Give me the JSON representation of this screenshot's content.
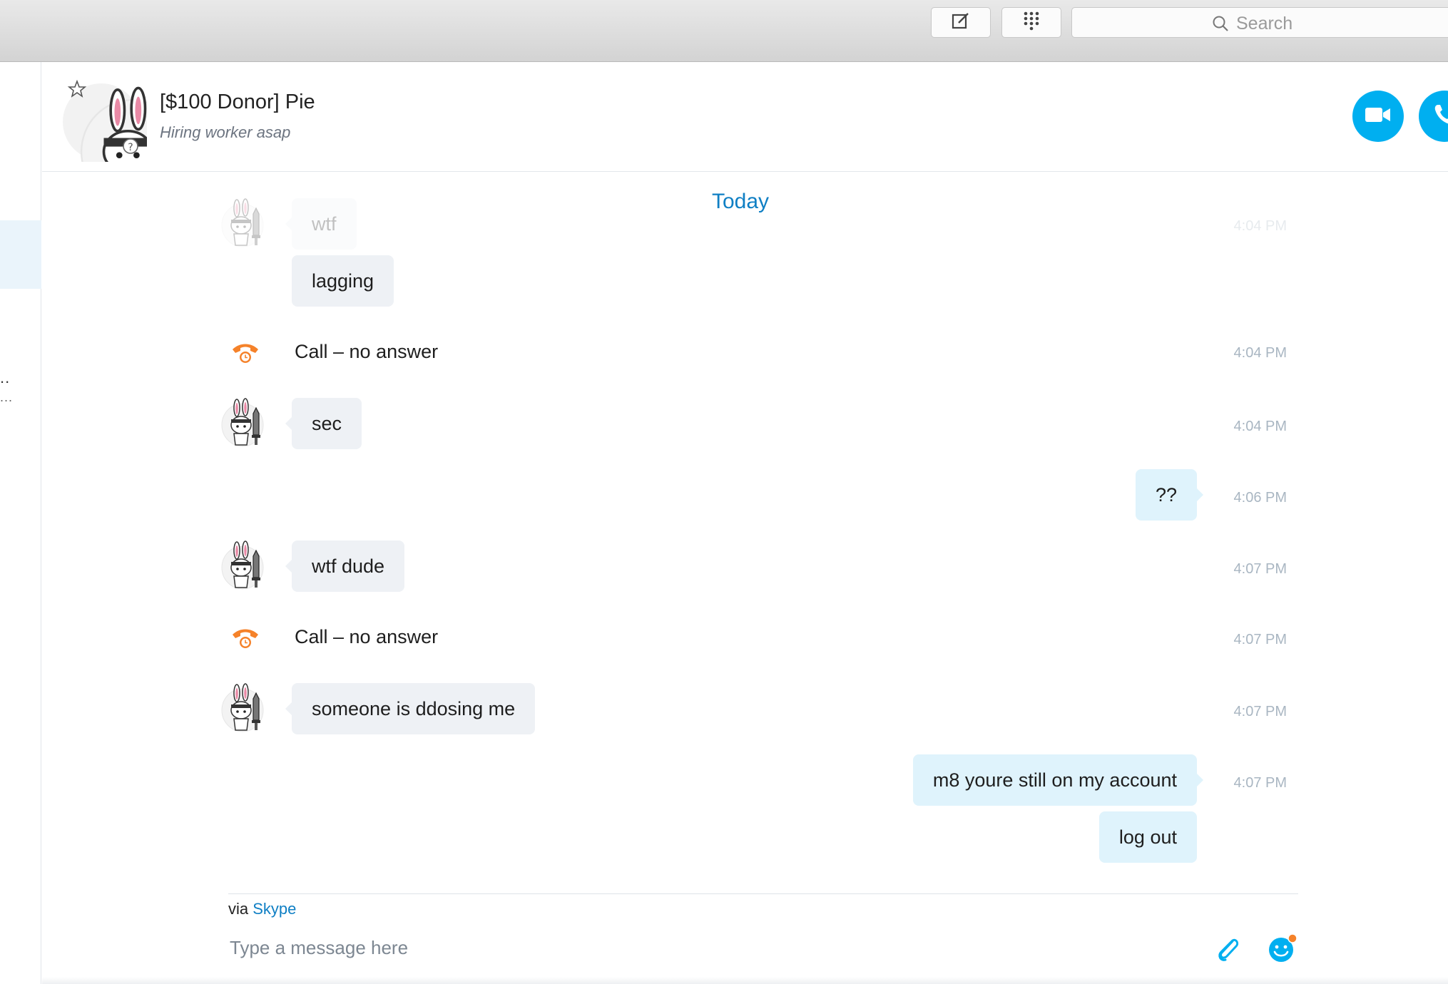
{
  "toolbar": {
    "search_placeholder": "Search",
    "compose_icon": "compose-icon",
    "dialpad_icon": "dialpad-icon"
  },
  "sidebar": {
    "truncated_1": "..",
    "truncated_2": "..."
  },
  "conversation": {
    "name": "[$100 Donor] Pie",
    "mood": "Hiring worker asap",
    "video_call_icon": "video-camera-icon",
    "audio_call_icon": "phone-icon"
  },
  "messages": {
    "day_label": "Today",
    "items": [
      {
        "type": "in",
        "text": "wtf",
        "time": "4:04 PM"
      },
      {
        "type": "in",
        "text": "lagging",
        "time": ""
      },
      {
        "type": "call",
        "text": "Call – no answer",
        "time": "4:04 PM"
      },
      {
        "type": "in",
        "text": "sec",
        "time": "4:04 PM"
      },
      {
        "type": "out",
        "text": "??",
        "time": "4:06 PM"
      },
      {
        "type": "in",
        "text": "wtf dude",
        "time": "4:07 PM"
      },
      {
        "type": "call",
        "text": "Call – no answer",
        "time": "4:07 PM"
      },
      {
        "type": "in",
        "text": "someone is ddosing me",
        "time": "4:07 PM"
      },
      {
        "type": "out",
        "text": "m8 youre still on my account",
        "time": "4:07 PM"
      },
      {
        "type": "out",
        "text": "log out",
        "time": ""
      }
    ]
  },
  "composer": {
    "via_prefix": "via",
    "via_service": "Skype",
    "placeholder": "Type a message here",
    "attach_icon": "paperclip-icon",
    "emoji_icon": "emoticon-icon"
  },
  "colors": {
    "accent_blue": "#00aff0",
    "link_blue": "#0f7fc4",
    "missed_call_orange": "#f5822a",
    "incoming_bubble": "#eef1f5",
    "outgoing_bubble": "#dff3fc"
  }
}
